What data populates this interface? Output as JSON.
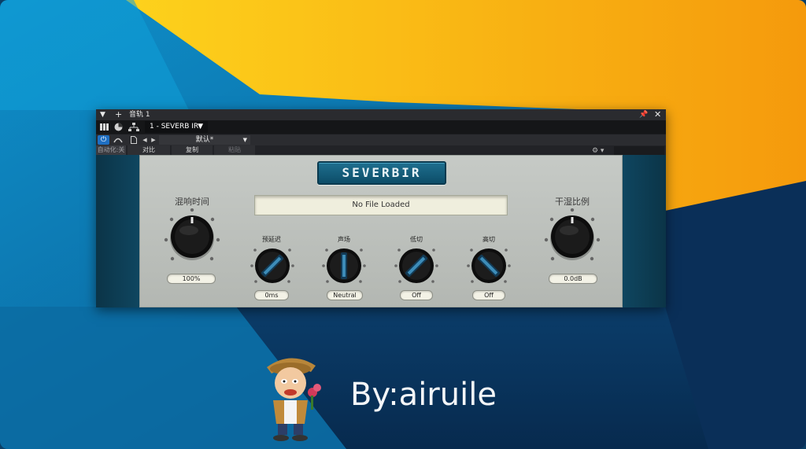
{
  "window": {
    "track_title": "音轨 1",
    "plugin_slot": "1 - SEVERB IR",
    "preset_name": "默认*",
    "automation_label": "自动化:关",
    "compare_label": "对比",
    "copy_label": "复制",
    "paste_label": "粘贴"
  },
  "plugin": {
    "logo": "SEVERBIR",
    "file_status": "No File Loaded",
    "reverb_time": {
      "label": "混响时间",
      "value": "100%"
    },
    "dry_wet": {
      "label": "干湿比例",
      "value": "0.0dB"
    },
    "predelay": {
      "label": "预延迟",
      "value": "0ms"
    },
    "stereo": {
      "label": "声场",
      "value": "Neutral"
    },
    "low_cut": {
      "label": "低切",
      "value": "Off"
    },
    "high_cut": {
      "label": "高切",
      "value": "Off"
    }
  },
  "caption": "By:airuile",
  "colors": {
    "accent": "#1f6fc2",
    "panel": "#bfc3bf",
    "plugin_frame": "#0e3a50",
    "logo_bg": "#176080"
  }
}
